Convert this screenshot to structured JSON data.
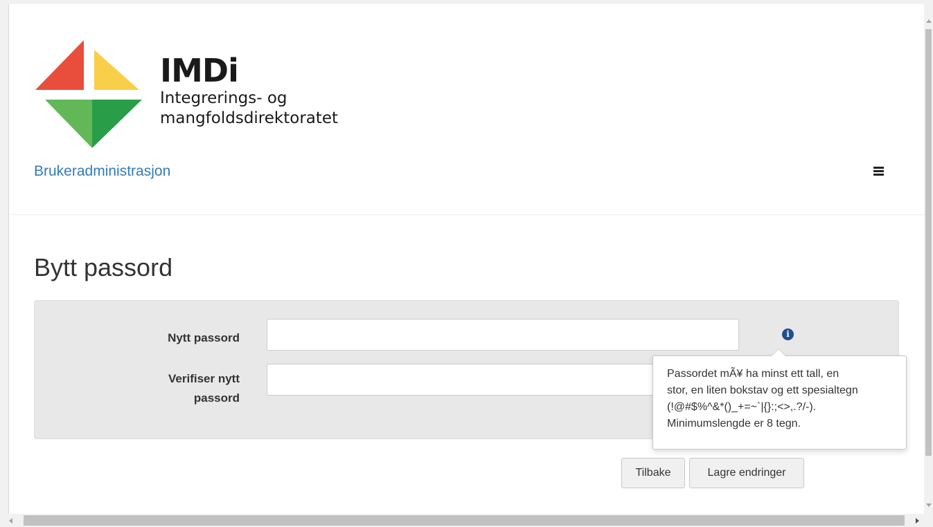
{
  "header": {
    "logo": {
      "title": "IMDi",
      "subtitle_line1": "Integrerings- og",
      "subtitle_line2": "mangfoldsdirektoratet",
      "colors": {
        "red": "#e94e3c",
        "yellow": "#f9cf4a",
        "green_light": "#62b857",
        "green_dark": "#2a9d48"
      }
    },
    "brand_link": "Brukeradministrasjon",
    "menu_icon": "hamburger-icon",
    "link_color": "#337ab7"
  },
  "page": {
    "title": "Bytt passord"
  },
  "form": {
    "new_password_label": "Nytt passord",
    "verify_label_line1": "Verifiser nytt",
    "verify_label_line2": "passord",
    "new_password_value": "",
    "verify_password_value": "",
    "info_icon": "info-circle-icon",
    "info_icon_glyph": "i"
  },
  "popover": {
    "lines": [
      "Passordet mÃ¥ ha minst ett tall, en",
      "stor, en liten bokstav og ett spesialtegn",
      "(!@#$%^&*()_+=~`|{}:;<>,.?/-).",
      "Minimumslengde er 8 tegn."
    ]
  },
  "buttons": {
    "back_label": "Tilbake",
    "save_label": "Lagre endringer"
  }
}
